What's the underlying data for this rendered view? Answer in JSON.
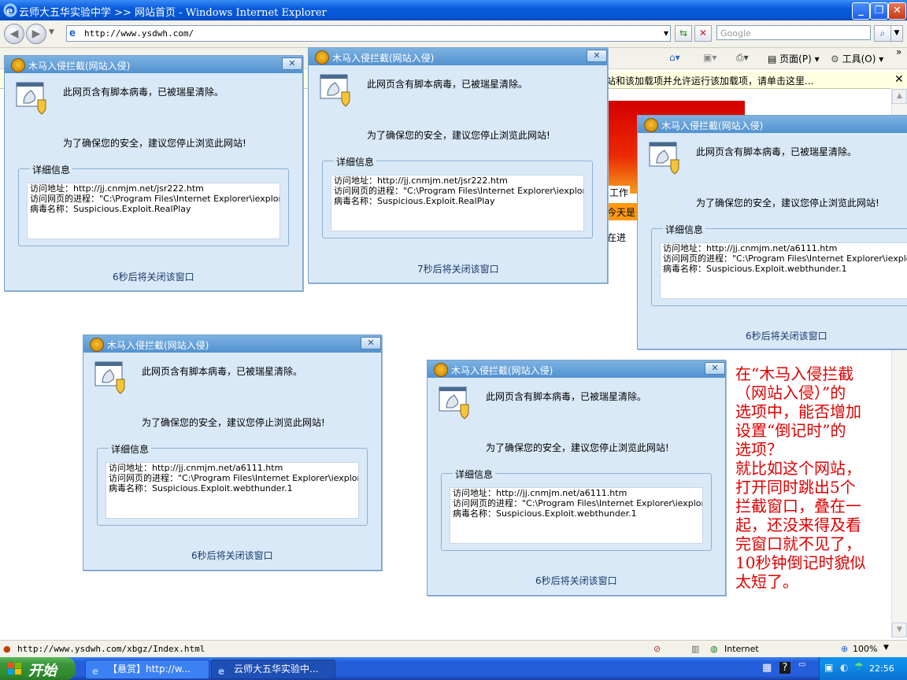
{
  "window": {
    "title": "云师大五华实验中学 >> 网站首页 - Windows Internet Explorer"
  },
  "address_bar": {
    "url": "http://www.ysdwh.com/",
    "search_placeholder": "Google"
  },
  "command_bar": {
    "page_label": "页面(P)",
    "tools_label": "工具(O)"
  },
  "info_bar": {
    "text": "站和该加载项并允许运行该加载项，请单击这里..."
  },
  "background_fragments": {
    "work": "工作",
    "today": "今天是",
    "running": "在进"
  },
  "dialogs": [
    {
      "title": "木马入侵拦截(网站入侵)",
      "message": "此网页含有脚本病毒，已被瑞星清除。",
      "advice": "为了确保您的安全，建议您停止浏览此网站!",
      "details_legend": "详细信息",
      "url_line": "访问地址：http://jj.cnmjm.net/jsr222.htm",
      "process_line": "访问网页的进程：\"C:\\Program Files\\Internet Explorer\\iexplore.exe\"",
      "virus_line": "病毒名称：Suspicious.Exploit.RealPlay",
      "countdown": "6秒后将关闭该窗口"
    },
    {
      "title": "木马入侵拦截(网站入侵)",
      "message": "此网页含有脚本病毒，已被瑞星清除。",
      "advice": "为了确保您的安全，建议您停止浏览此网站!",
      "details_legend": "详细信息",
      "url_line": "访问地址：http://jj.cnmjm.net/jsr222.htm",
      "process_line": "访问网页的进程：\"C:\\Program Files\\Internet Explorer\\iexplore.exe\"",
      "virus_line": "病毒名称：Suspicious.Exploit.RealPlay",
      "countdown": "7秒后将关闭该窗口"
    },
    {
      "title": "木马入侵拦截(网站入侵)",
      "message": "此网页含有脚本病毒，已被瑞星清除。",
      "advice": "为了确保您的安全，建议您停止浏览此网站!",
      "details_legend": "详细信息",
      "url_line": "访问地址：http://jj.cnmjm.net/a6111.htm",
      "process_line": "访问网页的进程：\"C:\\Program Files\\Internet Explorer\\iexplore.exe\"",
      "virus_line": "病毒名称：Suspicious.Exploit.webthunder.1",
      "countdown": "6秒后将关闭该窗口"
    },
    {
      "title": "木马入侵拦截(网站入侵)",
      "message": "此网页含有脚本病毒，已被瑞星清除。",
      "advice": "为了确保您的安全，建议您停止浏览此网站!",
      "details_legend": "详细信息",
      "url_line": "访问地址：http://jj.cnmjm.net/a6111.htm",
      "process_line": "访问网页的进程：\"C:\\Program Files\\Internet Explorer\\iexplore.exe\"",
      "virus_line": "病毒名称：Suspicious.Exploit.webthunder.1",
      "countdown": "6秒后将关闭该窗口"
    },
    {
      "title": "木马入侵拦截(网站入侵)",
      "message": "此网页含有脚本病毒，已被瑞星清除。",
      "advice": "为了确保您的安全，建议您停止浏览此网站!",
      "details_legend": "详细信息",
      "url_line": "访问地址：http://jj.cnmjm.net/a6111.htm",
      "process_line": "访问网页的进程：\"C:\\Program Files\\Internet Explorer\\iexplore.exe\"",
      "virus_line": "病毒名称：Suspicious.Exploit.webthunder.1",
      "countdown": "6秒后将关闭该窗口"
    }
  ],
  "annotation": {
    "lines": [
      "在“木马入侵拦截",
      "（网站入侵）”的",
      "选项中，能否增加",
      "设置“倒记时”的",
      "选项？",
      "就比如这个网站，",
      "打开同时跳出5个",
      "拦截窗口，叠在一",
      "起，还没来得及看",
      "完窗口就不见了，",
      "10秒钟倒记时貌似",
      "太短了。"
    ]
  },
  "status_bar": {
    "url": "http://www.ysdwh.com/xbgz/Index.html",
    "zone": "Internet",
    "zoom": "100%"
  },
  "taskbar": {
    "start_label": "开始",
    "items": [
      {
        "label": "【悬赏】http://w..."
      },
      {
        "label": "云师大五华实验中..."
      }
    ],
    "clock": "22:56"
  }
}
